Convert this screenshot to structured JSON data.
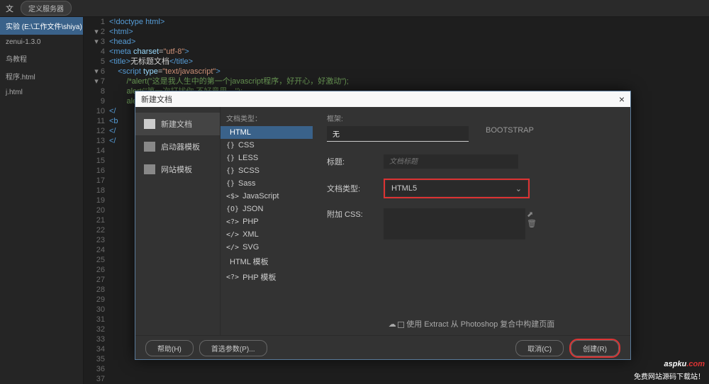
{
  "topbar": {
    "dropdown": "文",
    "define_server": "定义服务器"
  },
  "sidebar": {
    "items": [
      {
        "label": "实验 (E:\\工作文件\\shiya)",
        "selected": true
      },
      {
        "label": "zenui-1.3.0"
      },
      {
        "label": "鸟教程"
      },
      {
        "label": "程序.html"
      },
      {
        "label": "j.html"
      }
    ]
  },
  "editor": {
    "total_lines": 37,
    "code_lines": [
      {
        "n": 1,
        "fold": false,
        "html": "<span class='tag'>&lt;!doctype html&gt;</span>"
      },
      {
        "n": 2,
        "fold": true,
        "html": "<span class='tag'>&lt;html&gt;</span>"
      },
      {
        "n": 3,
        "fold": true,
        "html": "<span class='tag'>&lt;head&gt;</span>"
      },
      {
        "n": 4,
        "fold": false,
        "html": "<span class='tag'>&lt;meta</span> <span class='attr'>charset</span>=<span class='val'>\"utf-8\"</span><span class='tag'>&gt;</span>"
      },
      {
        "n": 5,
        "fold": false,
        "html": "<span class='tag'>&lt;title&gt;</span><span class='txt'>无标题文档</span><span class='tag'>&lt;/title&gt;</span>"
      },
      {
        "n": 6,
        "fold": true,
        "html": "    <span class='tag'>&lt;script</span> <span class='attr'>type</span>=<span class='val'>\"text/javascript\"</span><span class='tag'>&gt;</span>"
      },
      {
        "n": 7,
        "fold": true,
        "html": "        <span class='cm'>/*alert(\"这是我人生中的第一个javascript程序，好开心，好激动\");</span>"
      },
      {
        "n": 8,
        "fold": false,
        "html": "        <span class='cm'>alert(\"第一次打扰你,不好意思。\");</span>"
      },
      {
        "n": 9,
        "fold": false,
        "html": "        <span class='cm'>alert(\"第二次打扰你,不好意思。\");</span>"
      },
      {
        "n": 32,
        "fold": false,
        "html": "<span class='tag'>&lt;/</span>"
      },
      {
        "n": 34,
        "fold": false,
        "html": "<span class='tag'>&lt;b</span>"
      },
      {
        "n": 35,
        "fold": false,
        "html": "<span class='tag'>&lt;/</span>"
      },
      {
        "n": 36,
        "fold": false,
        "html": "<span class='tag'>&lt;/</span>"
      }
    ]
  },
  "dialog": {
    "title": "新建文档",
    "left": [
      {
        "label": "新建文档",
        "selected": true,
        "icon": "doc"
      },
      {
        "label": "启动器模板",
        "icon": "st"
      },
      {
        "label": "网站模板",
        "icon": "st"
      }
    ],
    "mid_header": "文档类型：",
    "mid": [
      {
        "icon": "</>",
        "label": "HTML",
        "selected": true
      },
      {
        "icon": "{}",
        "label": "CSS"
      },
      {
        "icon": "{}",
        "label": "LESS"
      },
      {
        "icon": "{}",
        "label": "SCSS"
      },
      {
        "icon": "{}",
        "label": "Sass"
      },
      {
        "icon": "&lt;$&gt;",
        "label": "JavaScript"
      },
      {
        "icon": "{O}",
        "label": "JSON"
      },
      {
        "icon": "&lt;?&gt;",
        "label": "PHP"
      },
      {
        "icon": "&lt;/&gt;",
        "label": "XML"
      },
      {
        "icon": "&lt;/&gt;",
        "label": "SVG"
      },
      {
        "icon": "</>",
        "label": "HTML 模板"
      },
      {
        "icon": "&lt;?&gt;",
        "label": "PHP 模板"
      }
    ],
    "right": {
      "framework_label": "框架:",
      "tabs": [
        {
          "label": "无",
          "sel": true
        },
        {
          "label": "BOOTSTRAP"
        }
      ],
      "title_label": "标题:",
      "title_placeholder": "文档标题",
      "doctype_label": "文档类型:",
      "doctype_value": "HTML5",
      "css_label": "附加 CSS:",
      "extract_line": "使用 Extract 从 Photoshop 复合中构建页面"
    },
    "footer": {
      "help": "帮助(H)",
      "prefs": "首选参数(P)...",
      "cancel": "取消(C)",
      "create": "创建(R)"
    }
  },
  "watermark": {
    "logo_pre": "aspku",
    "logo_suf": ".com",
    "sub": "免费网站源码下载站！"
  }
}
